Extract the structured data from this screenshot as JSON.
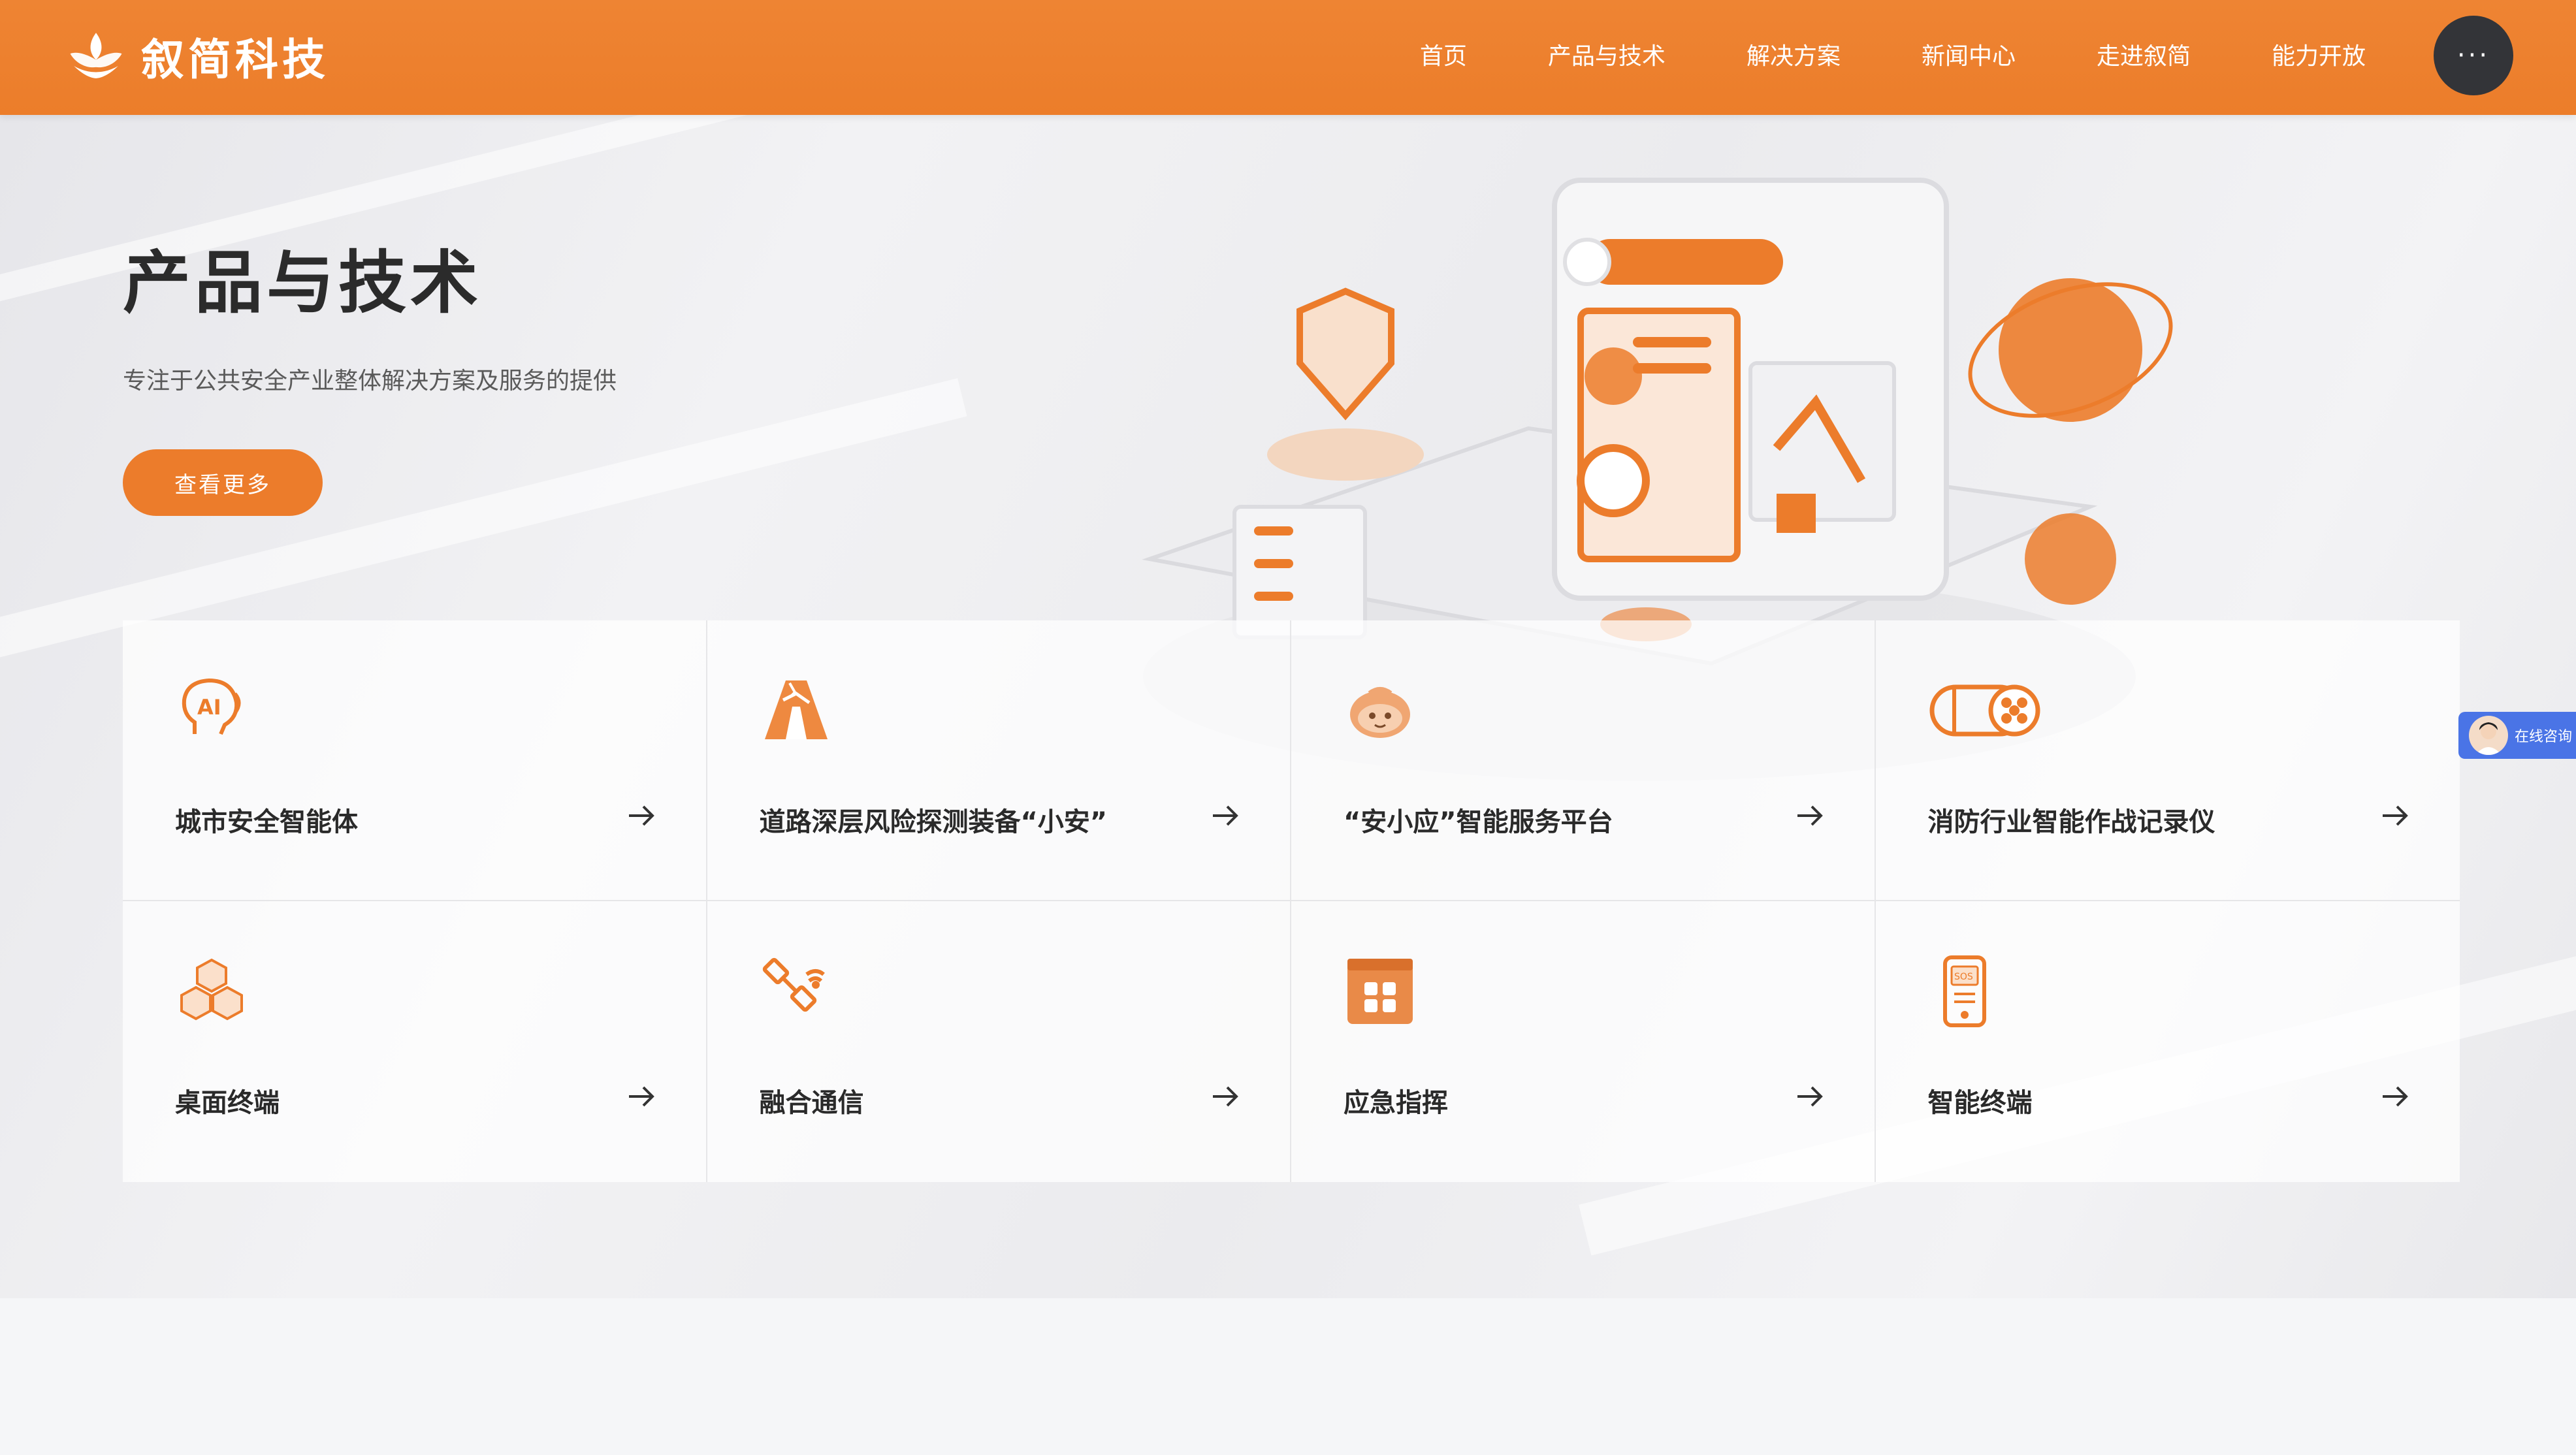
{
  "header": {
    "brand": "叙简科技",
    "logo_icon": "lotus-logo-icon",
    "more_label": "···",
    "nav": [
      {
        "label": "首页"
      },
      {
        "label": "产品与技术"
      },
      {
        "label": "解决方案"
      },
      {
        "label": "新闻中心"
      },
      {
        "label": "走进叙简"
      },
      {
        "label": "能力开放"
      }
    ]
  },
  "hero": {
    "title": "产品与技术",
    "subtitle": "专注于公共安全产业整体解决方案及服务的提供",
    "button_label": "查看更多"
  },
  "products": [
    {
      "label": "城市安全智能体",
      "icon": "ai-head-icon"
    },
    {
      "label": "道路深层风险探测装备“小安”",
      "icon": "road-radar-icon"
    },
    {
      "label": "“安小应”智能服务平台",
      "icon": "mascot-icon"
    },
    {
      "label": "消防行业智能作战记录仪",
      "icon": "cable-recorder-icon"
    },
    {
      "label": "桌面终端",
      "icon": "cubes-icon"
    },
    {
      "label": "融合通信",
      "icon": "satellite-icon"
    },
    {
      "label": "应急指挥",
      "icon": "command-panel-icon"
    },
    {
      "label": "智能终端",
      "icon": "smart-terminal-icon"
    }
  ],
  "chat_widget": {
    "label": "在线咨询"
  },
  "colors": {
    "accent": "#ec7c2b",
    "dark": "#333438"
  }
}
